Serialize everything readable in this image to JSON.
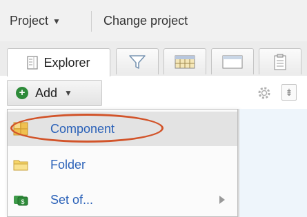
{
  "header": {
    "project_menu_label": "Project",
    "change_project_label": "Change project"
  },
  "tabs": [
    {
      "label": "Explorer",
      "icon": "explorer-icon",
      "active": true
    },
    {
      "label": "",
      "icon": "filter-icon",
      "active": false
    },
    {
      "label": "",
      "icon": "grid-icon",
      "active": false
    },
    {
      "label": "",
      "icon": "window-icon",
      "active": false
    },
    {
      "label": "",
      "icon": "clipboard-icon",
      "active": false
    }
  ],
  "toolbar": {
    "add_label": "Add",
    "add_icon": "plus-circle-icon"
  },
  "add_menu": {
    "items": [
      {
        "label": "Component",
        "icon": "component-icon",
        "selected": true,
        "has_submenu": false
      },
      {
        "label": "Folder",
        "icon": "folder-icon",
        "selected": false,
        "has_submenu": false
      },
      {
        "label": "Set of...",
        "icon": "set-icon",
        "selected": false,
        "has_submenu": true
      }
    ]
  },
  "colors": {
    "link_blue": "#2a61b8",
    "add_green": "#2e8b3a",
    "highlight_orange": "#d2542a"
  }
}
